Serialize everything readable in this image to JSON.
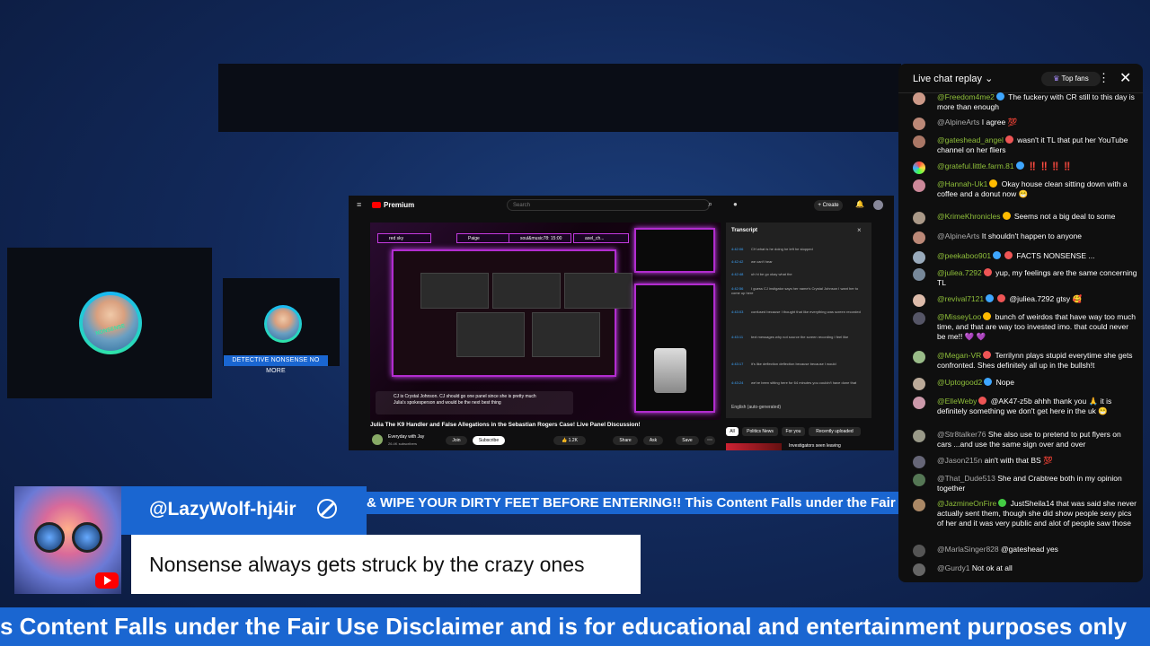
{
  "guest": {
    "name_tag": "DETECTIVE NONSENSE NO MORE",
    "avatar_caption": "NONSENSE"
  },
  "screen": {
    "brand": "Premium",
    "search_placeholder": "Search",
    "create_label": "Create",
    "transcript_title": "Transcript",
    "transcript_language": "English (auto-generated)",
    "transcript_rows": [
      {
        "time": "4:42:06",
        "text": "CH what is he doing he left he stopped"
      },
      {
        "time": "4:42:42",
        "text": "we can't hear"
      },
      {
        "time": "4:42:48",
        "text": "uh hi be go okay what the"
      },
      {
        "time": "4:42:56",
        "text": "I guess CJ instigator says her name's Crystal Johnson I want her to come up here"
      },
      {
        "time": "4:43:03",
        "text": "confused because I thought that like everything was screen recorded"
      },
      {
        "time": "4:43:11",
        "text": "text messages why not source the screen recording I feel like"
      },
      {
        "time": "4:43:17",
        "text": "it's like deflection deflection because because I would"
      },
      {
        "time": "4:43:24",
        "text": "we've been sitting here for 64 minutes you couldn't have done that"
      }
    ],
    "chips": [
      "red sky",
      "Paige",
      "soul&music78: 15:00",
      "axel_ch..."
    ],
    "video_caption_1": "CJ is Crystal Johnson. CJ should go one panel since she is pretty much",
    "video_caption_2": "Julia's spokesperson and would be the next best thing",
    "video_title": "Julia The K9 Handler and False Allegations in the Sebastian Rogers Case! Live Panel Discussion!",
    "channel": "Everyday with Jay",
    "subs": "26.4K subscribers",
    "join": "Join",
    "subscribe": "Subscribe",
    "likes": "1.2K",
    "share": "Share",
    "ask": "Ask",
    "save": "Save",
    "filters": [
      "All",
      "Politics News",
      "For you",
      "Recently uploaded"
    ],
    "related_title": "Investigators seen leaving"
  },
  "ticker": "& WIPE YOUR DIRTY FEET BEFORE ENTERING!! This Content Falls under the Fair Use",
  "bottom_ticker": "s Content Falls under the Fair Use Disclaimer and is for educational and entertainment purposes only",
  "comment": {
    "author": "@LazyWolf-hj4ir",
    "text": "Nonsense always gets struck by the crazy ones"
  },
  "chat": {
    "title": "Live chat replay",
    "top_fans": "Top fans",
    "messages": [
      {
        "author": "@Freedom4me2",
        "text": "The fuckery with CR still to this day is more than enough",
        "color": "#8fbf3a"
      },
      {
        "author": "@AlpineArts",
        "text": "I agree 💯",
        "color": "#aaa"
      },
      {
        "author": "@gateshead_angel",
        "text": "wasn't it TL that put her YouTube channel on her fliers",
        "color": "#8fbf3a"
      },
      {
        "author": "@grateful.little.farm.81",
        "text": "‼️ ‼️ ‼️ ‼️",
        "color": "#8fbf3a"
      },
      {
        "author": "@Hannah-Uk1",
        "text": "Okay house clean sitting down with a coffee and a donut now 😁",
        "color": "#8fbf3a"
      },
      {
        "author": "@KrimeKhronicles",
        "text": "Seems not a big deal to some",
        "color": "#8fbf3a"
      },
      {
        "author": "@AlpineArts",
        "text": "It shouldn't happen to anyone",
        "color": "#aaa"
      },
      {
        "author": "@peekaboo901",
        "text": "FACTS NONSENSE ...",
        "color": "#8fbf3a"
      },
      {
        "author": "@juliea.7292",
        "text": "yup, my feelings are the same concerning TL",
        "color": "#8fbf3a"
      },
      {
        "author": "@revival7121",
        "text": "@juliea.7292 gtsy 🥰",
        "color": "#8fbf3a"
      },
      {
        "author": "@MisseyLoo",
        "text": "bunch of weirdos that have way too much time, and that are way too invested imo. that could never be me!! 💜 💜",
        "color": "#8fbf3a"
      },
      {
        "author": "@Megan-VR",
        "text": "Terrilynn plays stupid everytime she gets confronted. Shes definitely all up in the bullsh!t",
        "color": "#8fbf3a"
      },
      {
        "author": "@Uptogood2",
        "text": "Nope",
        "color": "#8fbf3a"
      },
      {
        "author": "@ElleWeby",
        "text": "@AK47-z5b ahhh thank you 🙏 it is definitely something we don't get here in the uk 😁",
        "color": "#8fbf3a"
      },
      {
        "author": "@Str8talker76",
        "text": "She also use to pretend to put flyers on cars ...and use the same sign over and over",
        "color": "#aaa"
      },
      {
        "author": "@Jason215n",
        "text": "ain't with that BS 💯",
        "color": "#aaa"
      },
      {
        "author": "@That_Dude513",
        "text": "She and Crabtree both in my opinion together",
        "color": "#aaa"
      },
      {
        "author": "@JazmineOnFire",
        "text": "JustSheila14 that was said she never actually sent them, though she did show people sexy pics of her and it was very public and alot of people saw those",
        "color": "#8fbf3a"
      },
      {
        "author": "@MarlaSinger828",
        "text": "@gateshead yes",
        "color": "#aaa"
      },
      {
        "author": "@Gurdy1",
        "text": "Not ok at all",
        "color": "#aaa"
      }
    ]
  }
}
